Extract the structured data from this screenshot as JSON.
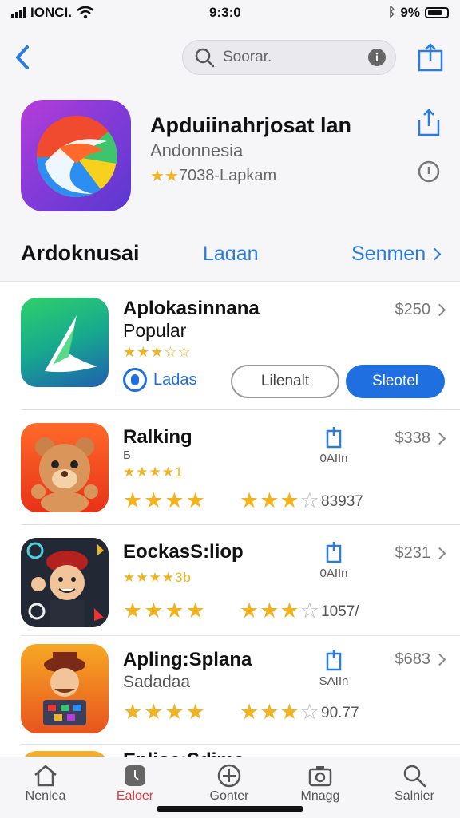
{
  "status": {
    "carrier": "IONCI.",
    "time": "9:3:0",
    "battery": "9%"
  },
  "nav": {
    "search_placeholder": "Soorar.",
    "mic_label": "i"
  },
  "hero": {
    "title": "Apduiinahrjosat lan",
    "subtitle": "Andonnesia",
    "rating_text": "7038-Lapkam"
  },
  "section": {
    "title": "Ardoknusai",
    "tab": "Laɑan",
    "more": "Senmen"
  },
  "rows": [
    {
      "name": "Aplokasinnana",
      "sub": "Popular",
      "stars": "★★★☆☆",
      "badge": "Ladas",
      "btn1": "Lilenalt",
      "btn2": "Sleotel",
      "price": "$250"
    },
    {
      "name": "Ralking",
      "sub": "Б",
      "small_stars": "★★★★1",
      "mini": "0AIIn",
      "price": "$338",
      "count": "83937"
    },
    {
      "name": "EockasS:liop",
      "small_stars": "★★★★3b",
      "mini": "0AIIn",
      "price": "$231",
      "count": "1057/"
    },
    {
      "name": "Apling:Splana",
      "sub": "Sadadaa",
      "mini": "SAIIn",
      "price": "$683",
      "count": "90.77"
    },
    {
      "name": "Eplioe:Sdima"
    }
  ],
  "tabs": [
    {
      "label": "Nenlea",
      "icon": "house-icon"
    },
    {
      "label": "Ealoer",
      "icon": "today-icon"
    },
    {
      "label": "Gonter",
      "icon": "compass-icon"
    },
    {
      "label": "Mnagg",
      "icon": "camera-icon"
    },
    {
      "label": "Salnier",
      "icon": "search-icon"
    }
  ],
  "colors": {
    "accent": "#1f6fe0",
    "star": "#f3b320",
    "active_tab": "#e03b3b"
  }
}
